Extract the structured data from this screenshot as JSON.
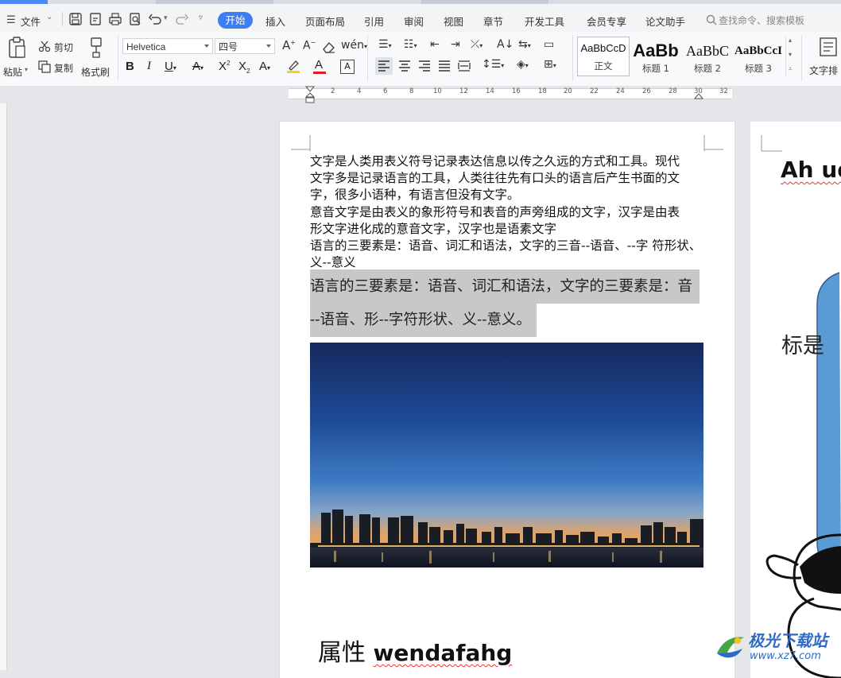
{
  "menubar": {
    "file_label": "文件",
    "tabs": [
      "开始",
      "插入",
      "页面布局",
      "引用",
      "审阅",
      "视图",
      "章节",
      "开发工具",
      "会员专享",
      "论文助手"
    ],
    "search_placeholder": "查找命令、搜索模板"
  },
  "ribbon": {
    "paste_label": "粘贴",
    "cut_label": "剪切",
    "copy_label": "复制",
    "format_painter_label": "格式刷",
    "font_name": "Helvetica",
    "font_size": "四号",
    "text_layout_label": "文字排",
    "styles": [
      {
        "preview": "AaBbCcD",
        "name": "正文"
      },
      {
        "preview": "AaBb",
        "name": "标题 1"
      },
      {
        "preview": "AaBbC",
        "name": "标题 2"
      },
      {
        "preview": "AaBbCcI",
        "name": "标题 3"
      }
    ]
  },
  "ruler": {
    "ticks": [
      "2",
      "4",
      "6",
      "8",
      "10",
      "12",
      "14",
      "16",
      "18",
      "20",
      "22",
      "24",
      "26",
      "28",
      "30",
      "32"
    ]
  },
  "document": {
    "paragraph_lines": [
      "文字是人类用表义符号记录表达信息以传之久远的方式和工具。现代",
      "文字多是记录语言的工具，人类往往先有口头的语言后产生书面的文",
      "字，很多小语种，有语言但没有文字。",
      "意音文字是由表义的象形符号和表音的声旁组成的文字，汉字是由表",
      "形文字进化成的意音文字，汉字也是语素文字",
      "语言的三要素是：语音、词汇和语法，文字的三音--语音、--字  符形状、",
      "义--意义"
    ],
    "highlight_lines": [
      "语言的三要素是：语音、词汇和语法，文字的三要素是：音",
      "--语音、形--字符形状、义--意义。"
    ],
    "heading_cn": "属性 ",
    "heading_en": "wendafahg"
  },
  "page2": {
    "text": "Ah ud",
    "title": "标是"
  },
  "watermark": {
    "title": "极光下载站",
    "url": "www.xz7.com"
  },
  "colors": {
    "accent": "#3d7ef4",
    "highlight": "#c8c8c8",
    "shape_fill": "#5b9bd5"
  }
}
